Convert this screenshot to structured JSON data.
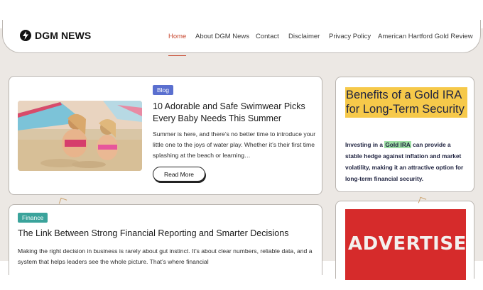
{
  "site": {
    "logo_text": "DGM NEWS"
  },
  "nav": {
    "items": [
      "Home",
      "About DGM News",
      "Contact",
      "Disclaimer",
      "Privacy Policy",
      "American Hartford Gold Review"
    ],
    "active": "Home"
  },
  "post1": {
    "category": "Blog",
    "title": "10 Adorable and Safe Swimwear Picks Every Baby Needs This Summer",
    "excerpt": "Summer is here, and there’s no better time to introduce your little one to the joys of water play. Whether it’s their first time splashing at the beach or learning…",
    "read_more": "Read More"
  },
  "post2": {
    "category": "Finance",
    "title": "The Link Between Strong Financial Reporting and Smarter Decisions",
    "excerpt": "Making the right decision in business is rarely about gut instinct. It’s about clear numbers, reliable data, and a system that helps leaders see the whole picture. That’s where financial"
  },
  "sidebar": {
    "ad_heading": "Benefits of a Gold IRA for Long-Term Security",
    "ad_body_before": "Investing in a ",
    "ad_body_highlight": "Gold IRA",
    "ad_body_after": " can provide a stable hedge against inflation and market volatility, making it an attractive option for long-term financial security.",
    "advertise_text": "ADVERTISE"
  },
  "colors": {
    "accent": "#c84a32",
    "badge_blog": "#5a6fcf",
    "badge_finance": "#3aa39b",
    "highlight_yellow": "#f6c94a",
    "highlight_green": "#9fe0a6",
    "advertise_red": "#d62b2b",
    "page_bg": "#ece8e4"
  }
}
